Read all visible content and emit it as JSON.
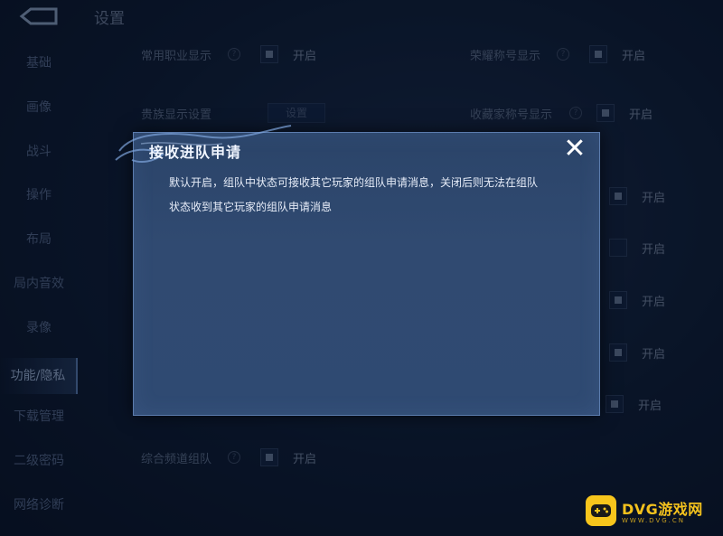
{
  "header": {
    "title": "设置"
  },
  "sidebar": {
    "items": [
      {
        "label": "基础"
      },
      {
        "label": "画像"
      },
      {
        "label": "战斗"
      },
      {
        "label": "操作"
      },
      {
        "label": "布局"
      },
      {
        "label": "局内音效"
      },
      {
        "label": "录像"
      },
      {
        "label": "功能/隐私"
      },
      {
        "label": "下载管理"
      },
      {
        "label": "二级密码"
      },
      {
        "label": "网络诊断"
      }
    ],
    "active_index": 7
  },
  "settings": {
    "row1_left": {
      "label": "常用职业显示",
      "status": "开启"
    },
    "row1_right": {
      "label": "荣耀称号显示",
      "status": "开启"
    },
    "row2_left": {
      "label": "贵族显示设置",
      "button": "设置"
    },
    "row2_right": {
      "label": "收藏家称号显示",
      "status": "开启"
    },
    "right_rows": [
      {
        "status": "开启"
      },
      {
        "status": "开启"
      },
      {
        "status": "开启"
      },
      {
        "status": "开启"
      },
      {
        "status": "开启"
      }
    ],
    "bottom_row": {
      "label": "综合频道组队",
      "status": "开启"
    }
  },
  "dialog": {
    "title": "接收进队申请",
    "close_symbol": "✕",
    "body_line1": "默认开启，组队中状态可接收其它玩家的组队申请消息，关闭后则无法在组队",
    "body_line2": "状态收到其它玩家的组队申请消息"
  },
  "watermark": {
    "brand": "DVG游戏网",
    "url": "WWW.DVG.CN"
  },
  "colors": {
    "accent": "#f4c21d",
    "dialog_bg": "#2f4a72",
    "dialog_border": "#5c7cad"
  },
  "icons": {
    "back": "back-arrow-icon",
    "close": "close-icon",
    "help": "question-icon",
    "logo": "gamepad-icon"
  }
}
